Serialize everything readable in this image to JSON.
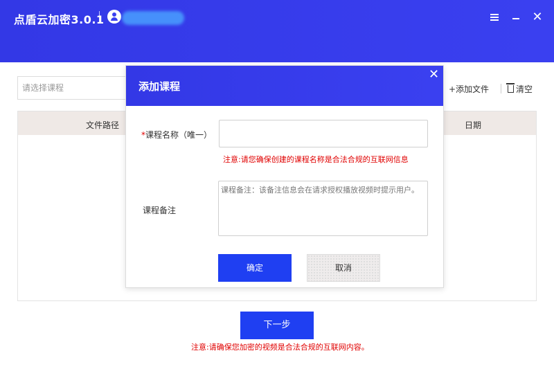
{
  "app": {
    "title": "点盾云加密3.0.1"
  },
  "toolbar": {
    "course_select_placeholder": "请选择课程",
    "add_file_label": "+添加文件",
    "clear_label": "清空"
  },
  "table": {
    "columns": [
      "文件路径",
      "日期"
    ]
  },
  "footer": {
    "next_label": "下一步",
    "notice": "注意:请确保您加密的视频是合法合规的互联网内容。"
  },
  "dialog": {
    "title": "添加课程",
    "name_required_mark": "*",
    "name_label": "课程名称（唯一）",
    "name_value": "",
    "name_notice": "注意:请您确保创建的课程名称是合法合规的互联网信息",
    "remark_label": "课程备注",
    "remark_placeholder": "课程备注：该备注信息会在请求授权播放视频时提示用户。",
    "confirm_label": "确定",
    "cancel_label": "取消"
  },
  "colors": {
    "primary": "#3a40f0",
    "button_blue": "#1f3ff2",
    "warning_red": "#e00000"
  }
}
